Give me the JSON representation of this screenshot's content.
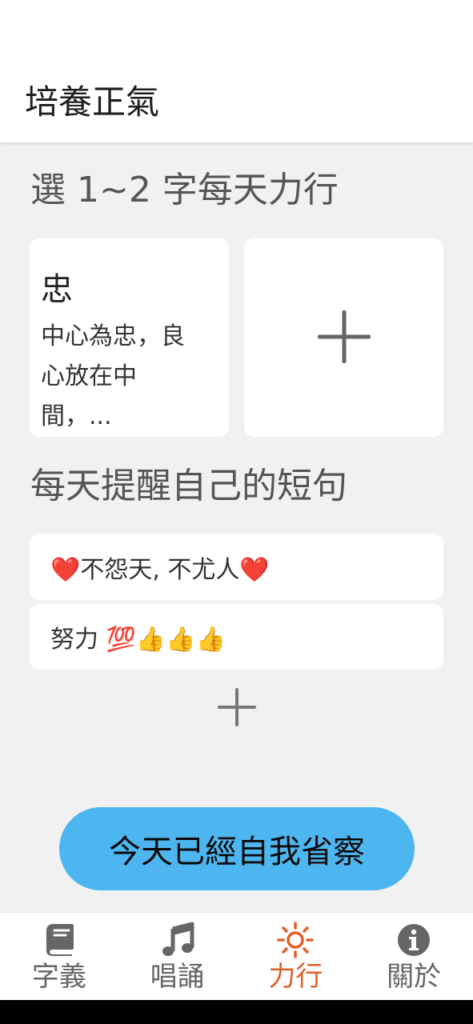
{
  "header": {
    "title": "培養正氣"
  },
  "sections": {
    "select_title": "選 1~2 字每天力行",
    "phrases_title": "每天提醒自己的短句"
  },
  "character_card": {
    "character": "忠",
    "description": "中心為忠，良心放在中間，..."
  },
  "phrases": [
    "❤️不怨天, 不尤人❤️",
    "努力 💯👍👍👍"
  ],
  "action_button": {
    "label": "今天已經自我省察"
  },
  "bottom_nav": {
    "active": "力行",
    "active_color": "#e0602b",
    "inactive_color": "#666666",
    "items": [
      {
        "label": "字義",
        "icon": "book-icon"
      },
      {
        "label": "唱誦",
        "icon": "music-note-icon"
      },
      {
        "label": "力行",
        "icon": "sun-icon"
      },
      {
        "label": "關於",
        "icon": "info-icon"
      }
    ]
  },
  "colors": {
    "button": "#4db6f0",
    "background": "#f1f1f1"
  }
}
